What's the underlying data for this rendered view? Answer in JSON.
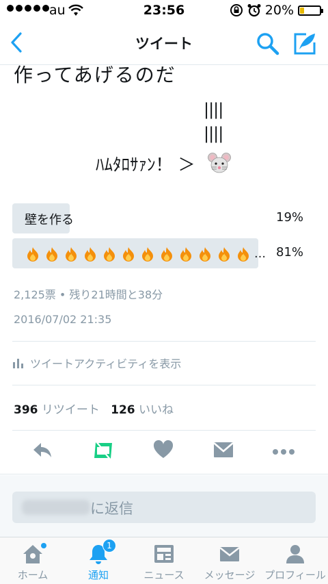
{
  "status": {
    "carrier": "au",
    "time": "23:56",
    "battery": "20%",
    "battery_level": 0.2
  },
  "nav": {
    "title": "ツイート"
  },
  "tweet": {
    "text_line1": "作ってあげるのだ",
    "art_line1": "||||",
    "art_line2": "||||",
    "art_line3": "ﾊﾑﾀﾛｻｧﾝ！ ＞"
  },
  "poll": {
    "options": [
      {
        "label": "壁を作る",
        "percent": "19%",
        "share": 0.19
      },
      {
        "label": "…",
        "percent": "81%",
        "share": 0.81,
        "icon": "fire-icon",
        "icon_count": 12
      }
    ],
    "votes_remaining": "2,125票 • 残り21時間と38分"
  },
  "timestamp": "2016/07/02 21:35",
  "activity_label": "ツイートアクティビティを表示",
  "stats": {
    "retweets": "396",
    "retweets_label": "リツイート",
    "likes": "126",
    "likes_label": "いいね"
  },
  "reply": {
    "placeholder_suffix": "に返信"
  },
  "tabs": [
    {
      "label": "ホーム"
    },
    {
      "label": "通知",
      "badge": "1"
    },
    {
      "label": "ニュース"
    },
    {
      "label": "メッセージ"
    },
    {
      "label": "プロフィール"
    }
  ],
  "colors": {
    "accent": "#1da1f2",
    "retweet": "#19cf86",
    "muted": "#8899a6",
    "poll_bar": "#e1e8ed"
  }
}
